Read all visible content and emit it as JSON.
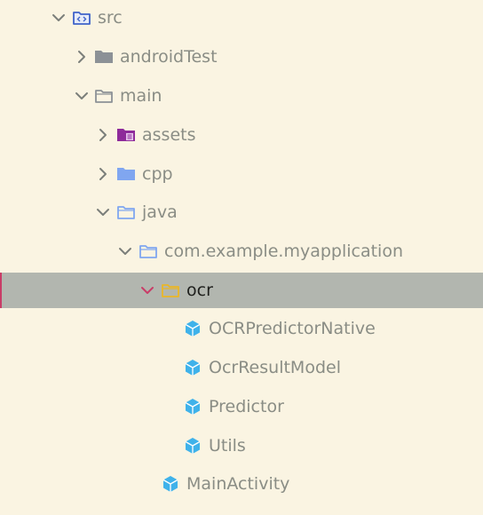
{
  "project_tree": {
    "items": [
      {
        "label": "src",
        "icon": "folder-source-root-icon",
        "expanded": true
      },
      {
        "label": "androidTest",
        "icon": "folder-icon",
        "expanded": false
      },
      {
        "label": "main",
        "icon": "folder-outline-icon",
        "expanded": true
      },
      {
        "label": "assets",
        "icon": "folder-resources-icon",
        "expanded": false
      },
      {
        "label": "cpp",
        "icon": "folder-icon",
        "expanded": false
      },
      {
        "label": "java",
        "icon": "folder-outline-icon",
        "expanded": true
      },
      {
        "label": "com.example.myapplication",
        "icon": "package-icon",
        "expanded": true
      },
      {
        "label": "ocr",
        "icon": "package-icon",
        "expanded": true,
        "selected": true
      },
      {
        "label": "OCRPredictorNative",
        "icon": "class-icon"
      },
      {
        "label": "OcrResultModel",
        "icon": "class-icon"
      },
      {
        "label": "Predictor",
        "icon": "class-icon"
      },
      {
        "label": "Utils",
        "icon": "class-icon"
      },
      {
        "label": "MainActivity",
        "icon": "class-icon"
      }
    ]
  },
  "colors": {
    "background": "#FAF4E2",
    "selection": "#B2B6AF",
    "selection_accent": "#C93D67",
    "text": "#8A8D85",
    "selected_text": "#1E1F1C",
    "folder_gray": "#8C9196",
    "folder_blue": "#80A6F0",
    "folder_source": "#3F63C9",
    "folder_resources": "#8E2B9A",
    "package_yellow": "#EAB728",
    "class_cyan": "#3FB2EA"
  }
}
